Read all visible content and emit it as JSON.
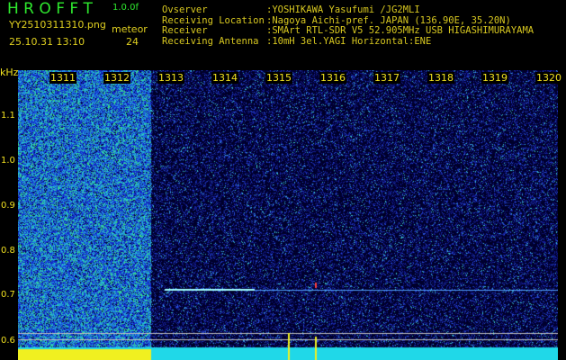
{
  "app": {
    "title": "H R O F F T",
    "version": "1.0.0f"
  },
  "file": {
    "name": "YY2510311310.png",
    "datetime": "25.10.31 13:10"
  },
  "meteor": {
    "label": "meteor",
    "count": "24"
  },
  "info": [
    {
      "label": "Ovserver",
      "value": ":YOSHIKAWA Yasufumi /JG2MLI"
    },
    {
      "label": "Receiving Location",
      "value": ":Nagoya Aichi-pref. JAPAN (136.90E, 35.20N)"
    },
    {
      "label": "Receiver",
      "value": ":SMArt RTL-SDR V5 52.905MHz USB HIGASHIMURAYAMA"
    },
    {
      "label": "Receiving Antenna",
      "value": ":10mH 3el.YAGI Horizontal:ENE"
    }
  ],
  "axis": {
    "y_unit": "kHz",
    "y_ticks": [
      "1.1",
      "1.0",
      "0.9",
      "0.8",
      "0.7",
      "0.6"
    ],
    "x_ticks": [
      "1311",
      "1312",
      "1313",
      "1314",
      "1315",
      "1316",
      "1317",
      "1318",
      "1319",
      "1320"
    ]
  },
  "colors": {
    "title": "#2ee82e",
    "text": "#e0d020",
    "trace": "#a0ffff"
  }
}
